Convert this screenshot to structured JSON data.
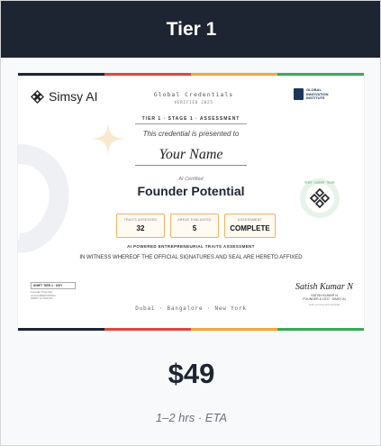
{
  "header": {
    "title": "Tier 1"
  },
  "certificate": {
    "brand": "Simsy AI",
    "global_credentials": "Global Credentials",
    "verified": "VERIFIED 2025",
    "institute": [
      "GLOBAL",
      "INNOVATION",
      "INSTITUTE"
    ],
    "tier_line": "TIER 1 · STAGE 1 · ASSESSMENT",
    "presented_to": "This credential is presented to",
    "recipient_name": "Your Name",
    "ai_certified": "AI Certified",
    "title": "Founder Potential",
    "stats": [
      {
        "label": "TRAITS ASSESSED",
        "value": "32"
      },
      {
        "label": "AREAS EVALUATED",
        "value": "5"
      },
      {
        "label": "ASSESSMENT",
        "value": "COMPLETE"
      }
    ],
    "powered_by": "AI POWERED ENTREPRENEURIAL TRAITS ASSESSMENT",
    "witness": "IN WITNESS WHEREOF THE OFFICIAL SIGNATURES AND SEAL ARE HERETO AFFIXED",
    "left_badge_title": "SHIFT TIER 1 · KEY",
    "left_badge_text": [
      "Founder Potential",
      "AI ACCREDITATION",
      "SIMSY AI TRAITS"
    ],
    "cities": "Dubai · Bangalore · New York",
    "signature": "Satish Kumar N",
    "signer_name": "SATISH KUMAR N",
    "signer_title": "FOUNDER & CEO · SIMSY AI",
    "verify_note": "Verify at simsy.ai/credentials",
    "seal_text": "Build · Launch · Scale",
    "stripe_colors": [
      "#1d2532",
      "#e0473c",
      "#f0a93b",
      "#3aa957"
    ]
  },
  "price": "$49",
  "eta": "1–2 hrs · ETA"
}
